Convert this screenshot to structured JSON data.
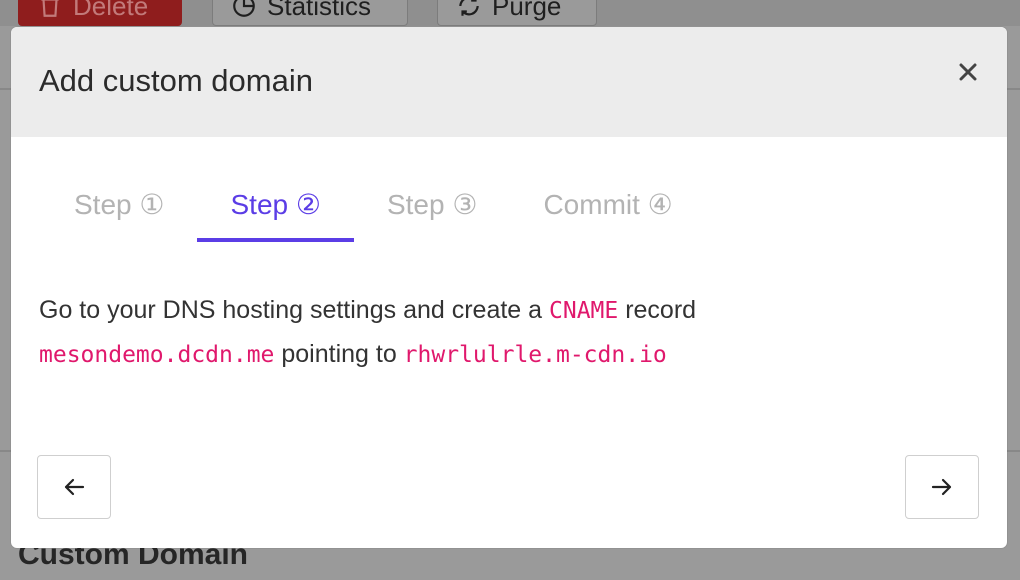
{
  "background": {
    "toolbar": {
      "delete_label": "Delete",
      "statistics_label": "Statistics",
      "purge_label": "Purge"
    },
    "section_heading": "Custom Domain"
  },
  "modal": {
    "title": "Add custom domain",
    "close_icon": "close-icon",
    "tabs": [
      {
        "label": "Step ①",
        "active": false
      },
      {
        "label": "Step ②",
        "active": true
      },
      {
        "label": "Step ③",
        "active": false
      },
      {
        "label": "Commit ④",
        "active": false
      }
    ],
    "instructions": {
      "part1": "Go to your DNS hosting settings and create a ",
      "record_type": "CNAME",
      "part2": " record",
      "domain": "mesondemo.dcdn.me",
      "part3": " pointing to ",
      "target": "rhwrlulrle.m-cdn.io"
    },
    "prev_icon": "arrow-left-icon",
    "next_icon": "arrow-right-icon"
  },
  "colors": {
    "accent": "#5b3de6",
    "code": "#e0186c",
    "header_bg": "#ececec"
  }
}
